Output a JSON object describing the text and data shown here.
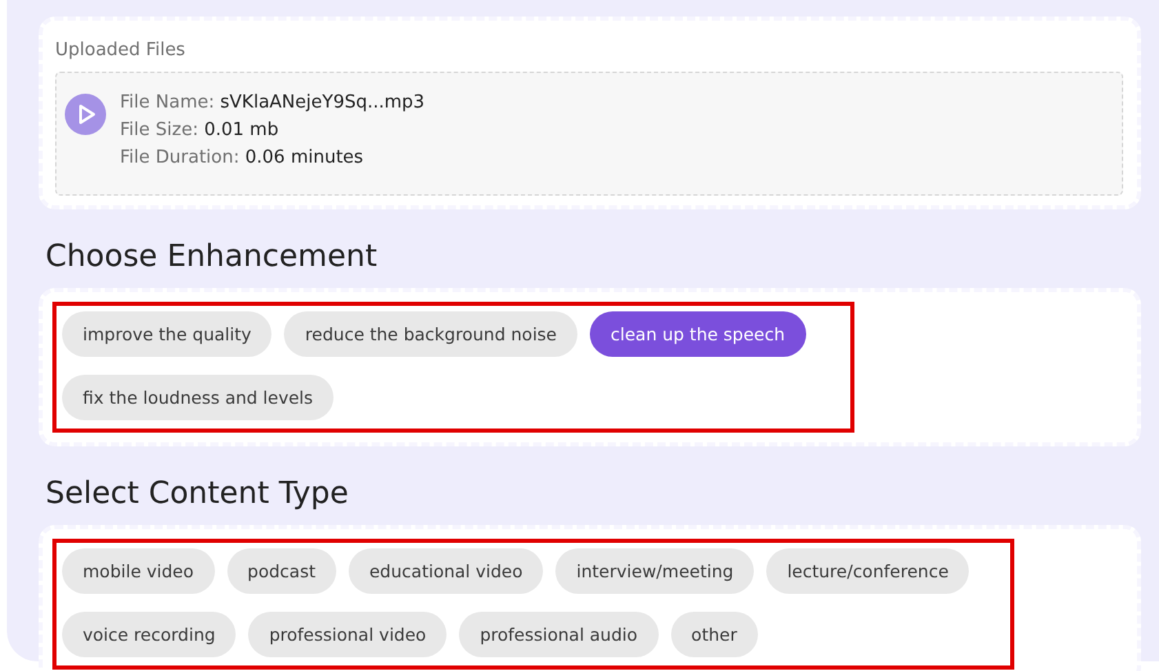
{
  "uploaded_files": {
    "title": "Uploaded Files",
    "files": [
      {
        "fields": [
          {
            "label": "File Name:",
            "value": "sVKlaANejeY9Sq...mp3"
          },
          {
            "label": "File Size:",
            "value": "0.01 mb"
          },
          {
            "label": "File Duration:",
            "value": "0.06 minutes"
          }
        ]
      }
    ]
  },
  "sections": [
    {
      "title": "Choose Enhancement",
      "highlighted": true,
      "options": [
        {
          "label": "improve the quality",
          "selected": false
        },
        {
          "label": "reduce the background noise",
          "selected": false
        },
        {
          "label": "clean up the speech",
          "selected": true
        },
        {
          "label": "fix the loudness and levels",
          "selected": false
        }
      ]
    },
    {
      "title": "Select Content Type",
      "highlighted": true,
      "options": [
        {
          "label": "mobile video",
          "selected": false
        },
        {
          "label": "podcast",
          "selected": false
        },
        {
          "label": "educational video",
          "selected": false
        },
        {
          "label": "interview/meeting",
          "selected": false
        },
        {
          "label": "lecture/conference",
          "selected": false
        },
        {
          "label": "voice recording",
          "selected": false
        },
        {
          "label": "professional video",
          "selected": false
        },
        {
          "label": "professional audio",
          "selected": false
        },
        {
          "label": "other",
          "selected": false
        }
      ]
    }
  ]
}
